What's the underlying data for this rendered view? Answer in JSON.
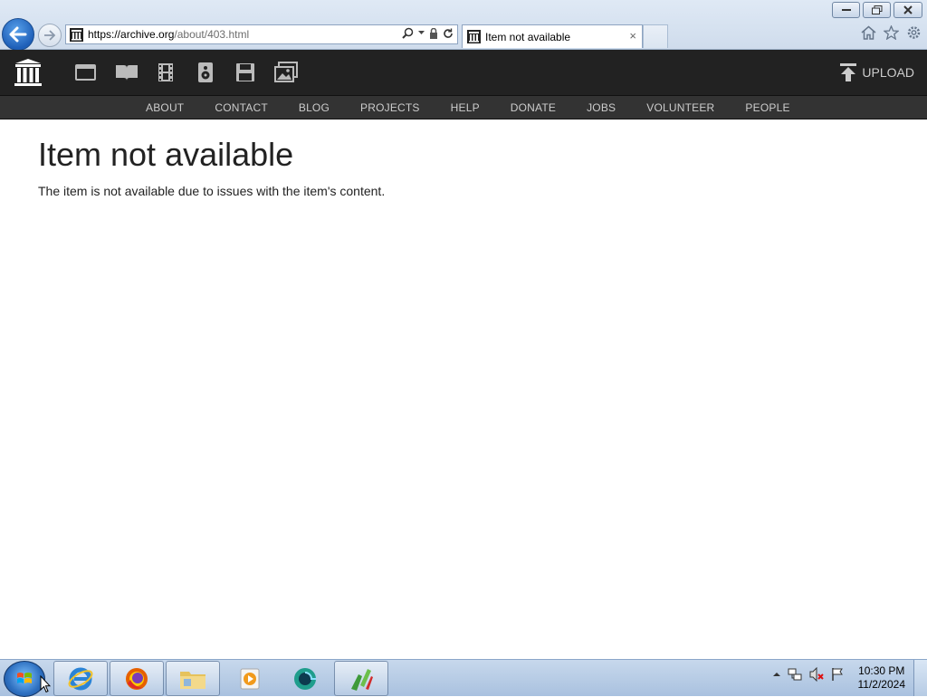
{
  "browser": {
    "url_host": "https://archive.org",
    "url_path": "/about/403.html",
    "tab_title": "Item not available",
    "tab_close": "×",
    "icons": [
      "back-arrow-icon",
      "forward-arrow-icon",
      "search-icon",
      "dropdown-icon",
      "lock-icon",
      "refresh-icon",
      "home-icon",
      "favorites-star-icon",
      "settings-gear-icon"
    ]
  },
  "site": {
    "media_icons": [
      "web-icon",
      "texts-icon",
      "video-icon",
      "audio-icon",
      "software-icon",
      "images-icon"
    ],
    "upload_label": "UPLOAD",
    "nav": [
      "ABOUT",
      "CONTACT",
      "BLOG",
      "PROJECTS",
      "HELP",
      "DONATE",
      "JOBS",
      "VOLUNTEER",
      "PEOPLE"
    ]
  },
  "content": {
    "title": "Item not available",
    "message": "The item is not available due to issues with the item's content."
  },
  "taskbar": {
    "apps": [
      "internet-explorer",
      "firefox",
      "file-explorer",
      "media-player",
      "generic-app",
      "paint-tool"
    ],
    "time": "10:30 PM",
    "date": "11/2/2024"
  },
  "colors": {
    "header_bg": "#222222",
    "nav_bg": "#333333",
    "nav_text": "#cccccc",
    "ie_accent": "#1e5fb8"
  }
}
